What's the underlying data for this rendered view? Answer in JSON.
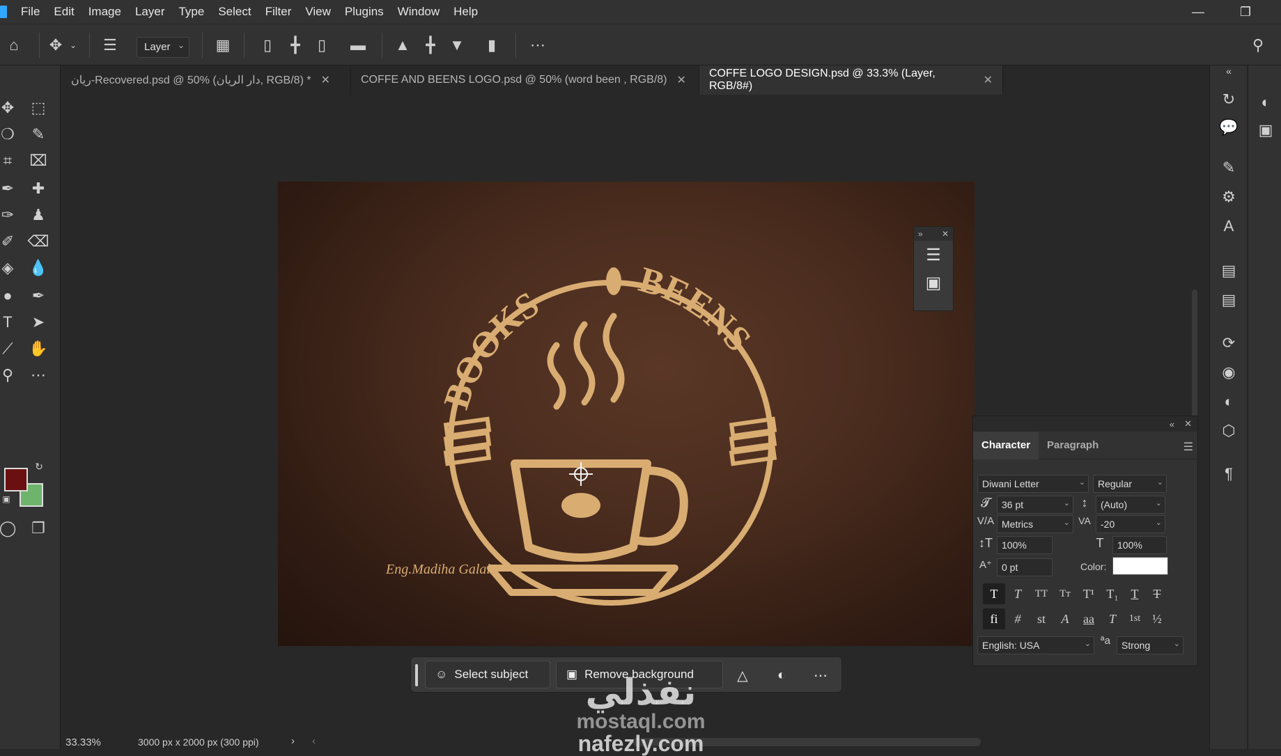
{
  "menubar": {
    "items": [
      "File",
      "Edit",
      "Image",
      "Layer",
      "Type",
      "Select",
      "Filter",
      "View",
      "Plugins",
      "Window",
      "Help"
    ],
    "minimize_icon": "minimize-icon",
    "restore_icon": "restore-icon"
  },
  "options": {
    "layer_select": "Layer"
  },
  "tabs": [
    {
      "label": "ريان-Recovered.psd @ 50% (دار الريان, RGB/8) *",
      "active": false
    },
    {
      "label": "COFFE AND BEENS LOGO.psd @ 50% (word been , RGB/8)",
      "active": false
    },
    {
      "label": "COFFE LOGO DESIGN.psd @ 33.3% (Layer, RGB/8#)",
      "active": true
    }
  ],
  "artwork": {
    "arc_text_left": "BOOKS",
    "arc_text_right": "BEENS",
    "signature": "Eng.Madiha Galal",
    "accent": "#d9ad72"
  },
  "colors": {
    "foreground": "#6b1010",
    "background": "#6fb46c"
  },
  "character": {
    "tab_character": "Character",
    "tab_paragraph": "Paragraph",
    "font_family": "Diwani Letter",
    "font_style": "Regular",
    "size": "36 pt",
    "leading": "(Auto)",
    "kerning": "Metrics",
    "tracking": "-20",
    "vertical_scale": "100%",
    "horizontal_scale": "100%",
    "baseline_shift": "0 pt",
    "color_label": "Color:",
    "color_value": "#ffffff",
    "language": "English: USA",
    "antialias": "Strong"
  },
  "taskbar": {
    "select_subject": "Select subject",
    "remove_background": "Remove background"
  },
  "status": {
    "zoom": "33.33%",
    "doc_info": "3000 px x 2000 px (300 ppi)"
  },
  "watermark": {
    "arabic": "نفذلي",
    "line1": "mostaql.com",
    "line2": "nafezly.com"
  }
}
